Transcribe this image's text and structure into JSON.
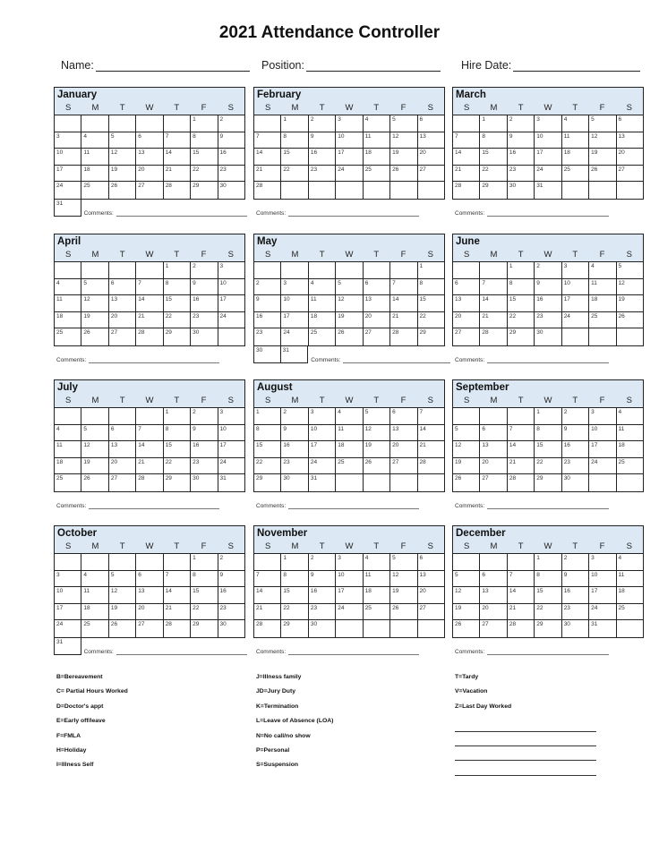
{
  "title": "2021 Attendance Controller",
  "info": {
    "name_label": "Name:",
    "position_label": "Position:",
    "hire_date_label": "Hire Date:"
  },
  "dow": [
    "S",
    "M",
    "T",
    "W",
    "T",
    "F",
    "S"
  ],
  "comments_label": "Comments:",
  "months": [
    {
      "name": "January",
      "weeks": [
        [
          "",
          "",
          "",
          "",
          "",
          "1",
          "2"
        ],
        [
          "3",
          "4",
          "5",
          "6",
          "7",
          "8",
          "9"
        ],
        [
          "10",
          "11",
          "12",
          "13",
          "14",
          "15",
          "16"
        ],
        [
          "17",
          "18",
          "19",
          "20",
          "21",
          "22",
          "23"
        ],
        [
          "24",
          "25",
          "26",
          "27",
          "28",
          "29",
          "30"
        ]
      ],
      "extra": [
        "31"
      ]
    },
    {
      "name": "February",
      "weeks": [
        [
          "",
          "1",
          "2",
          "3",
          "4",
          "5",
          "6"
        ],
        [
          "7",
          "8",
          "9",
          "10",
          "11",
          "12",
          "13"
        ],
        [
          "14",
          "15",
          "16",
          "17",
          "18",
          "19",
          "20"
        ],
        [
          "21",
          "22",
          "23",
          "24",
          "25",
          "26",
          "27"
        ],
        [
          "28",
          "",
          "",
          "",
          "",
          "",
          ""
        ]
      ],
      "extra": []
    },
    {
      "name": "March",
      "weeks": [
        [
          "",
          "1",
          "2",
          "3",
          "4",
          "5",
          "6"
        ],
        [
          "7",
          "8",
          "9",
          "10",
          "11",
          "12",
          "13"
        ],
        [
          "14",
          "15",
          "16",
          "17",
          "18",
          "19",
          "20"
        ],
        [
          "21",
          "22",
          "23",
          "24",
          "25",
          "26",
          "27"
        ],
        [
          "28",
          "29",
          "30",
          "31",
          "",
          "",
          ""
        ]
      ],
      "extra": []
    },
    {
      "name": "April",
      "weeks": [
        [
          "",
          "",
          "",
          "",
          "1",
          "2",
          "3"
        ],
        [
          "4",
          "5",
          "6",
          "7",
          "8",
          "9",
          "10"
        ],
        [
          "11",
          "12",
          "13",
          "14",
          "15",
          "16",
          "17"
        ],
        [
          "18",
          "19",
          "20",
          "21",
          "22",
          "23",
          "24"
        ],
        [
          "25",
          "26",
          "27",
          "28",
          "29",
          "30",
          ""
        ]
      ],
      "extra": []
    },
    {
      "name": "May",
      "weeks": [
        [
          "",
          "",
          "",
          "",
          "",
          "",
          "1"
        ],
        [
          "2",
          "3",
          "4",
          "5",
          "6",
          "7",
          "8"
        ],
        [
          "9",
          "10",
          "11",
          "12",
          "13",
          "14",
          "15"
        ],
        [
          "16",
          "17",
          "18",
          "19",
          "20",
          "21",
          "22"
        ],
        [
          "23",
          "24",
          "25",
          "26",
          "27",
          "28",
          "29"
        ]
      ],
      "extra": [
        "30",
        "31"
      ]
    },
    {
      "name": "June",
      "weeks": [
        [
          "",
          "",
          "1",
          "2",
          "3",
          "4",
          "5"
        ],
        [
          "6",
          "7",
          "8",
          "9",
          "10",
          "11",
          "12"
        ],
        [
          "13",
          "14",
          "15",
          "16",
          "17",
          "18",
          "19"
        ],
        [
          "20",
          "21",
          "22",
          "23",
          "24",
          "25",
          "26"
        ],
        [
          "27",
          "28",
          "29",
          "30",
          "",
          "",
          ""
        ]
      ],
      "extra": []
    },
    {
      "name": "July",
      "weeks": [
        [
          "",
          "",
          "",
          "",
          "1",
          "2",
          "3"
        ],
        [
          "4",
          "5",
          "6",
          "7",
          "8",
          "9",
          "10"
        ],
        [
          "11",
          "12",
          "13",
          "14",
          "15",
          "16",
          "17"
        ],
        [
          "18",
          "19",
          "20",
          "21",
          "22",
          "23",
          "24"
        ],
        [
          "25",
          "26",
          "27",
          "28",
          "29",
          "30",
          "31"
        ]
      ],
      "extra": []
    },
    {
      "name": "August",
      "weeks": [
        [
          "1",
          "2",
          "3",
          "4",
          "5",
          "6",
          "7"
        ],
        [
          "8",
          "9",
          "10",
          "11",
          "12",
          "13",
          "14"
        ],
        [
          "15",
          "16",
          "17",
          "18",
          "19",
          "20",
          "21"
        ],
        [
          "22",
          "23",
          "24",
          "25",
          "26",
          "27",
          "28"
        ],
        [
          "29",
          "30",
          "31",
          "",
          "",
          "",
          ""
        ]
      ],
      "extra": []
    },
    {
      "name": "September",
      "weeks": [
        [
          "",
          "",
          "",
          "1",
          "2",
          "3",
          "4"
        ],
        [
          "5",
          "6",
          "7",
          "8",
          "9",
          "10",
          "11"
        ],
        [
          "12",
          "13",
          "14",
          "15",
          "16",
          "17",
          "18"
        ],
        [
          "19",
          "20",
          "21",
          "22",
          "23",
          "24",
          "25"
        ],
        [
          "26",
          "27",
          "28",
          "29",
          "30",
          "",
          ""
        ]
      ],
      "extra": []
    },
    {
      "name": "October",
      "weeks": [
        [
          "",
          "",
          "",
          "",
          "",
          "1",
          "2"
        ],
        [
          "3",
          "4",
          "5",
          "6",
          "7",
          "8",
          "9"
        ],
        [
          "10",
          "11",
          "12",
          "13",
          "14",
          "15",
          "16"
        ],
        [
          "17",
          "18",
          "19",
          "20",
          "21",
          "22",
          "23"
        ],
        [
          "24",
          "25",
          "26",
          "27",
          "28",
          "29",
          "30"
        ]
      ],
      "extra": [
        "31"
      ]
    },
    {
      "name": "November",
      "weeks": [
        [
          "",
          "1",
          "2",
          "3",
          "4",
          "5",
          "6"
        ],
        [
          "7",
          "8",
          "9",
          "10",
          "11",
          "12",
          "13"
        ],
        [
          "14",
          "15",
          "16",
          "17",
          "18",
          "19",
          "20"
        ],
        [
          "21",
          "22",
          "23",
          "24",
          "25",
          "26",
          "27"
        ],
        [
          "28",
          "29",
          "30",
          "",
          "",
          "",
          ""
        ]
      ],
      "extra": []
    },
    {
      "name": "December",
      "weeks": [
        [
          "",
          "",
          "",
          "1",
          "2",
          "3",
          "4"
        ],
        [
          "5",
          "6",
          "7",
          "8",
          "9",
          "10",
          "11"
        ],
        [
          "12",
          "13",
          "14",
          "15",
          "16",
          "17",
          "18"
        ],
        [
          "19",
          "20",
          "21",
          "22",
          "23",
          "24",
          "25"
        ],
        [
          "26",
          "27",
          "28",
          "29",
          "30",
          "31",
          ""
        ]
      ],
      "extra": []
    }
  ],
  "legend": {
    "col1": [
      "B=Bereavement",
      "C= Partial Hours Worked",
      "D=Doctor's appt",
      "E=Early off/leave",
      "F=FMLA",
      "H=Holiday",
      "I=Illness Self"
    ],
    "col2": [
      "J=Illness family",
      "JD=Jury Duty",
      "K=Termination",
      "L=Leave of Absence (LOA)",
      "N=No call/no show",
      "P=Personal",
      "S=Suspension"
    ],
    "col3": [
      "T=Tardy",
      "V=Vacation",
      "Z=Last Day Worked"
    ],
    "blank_lines": 4
  }
}
